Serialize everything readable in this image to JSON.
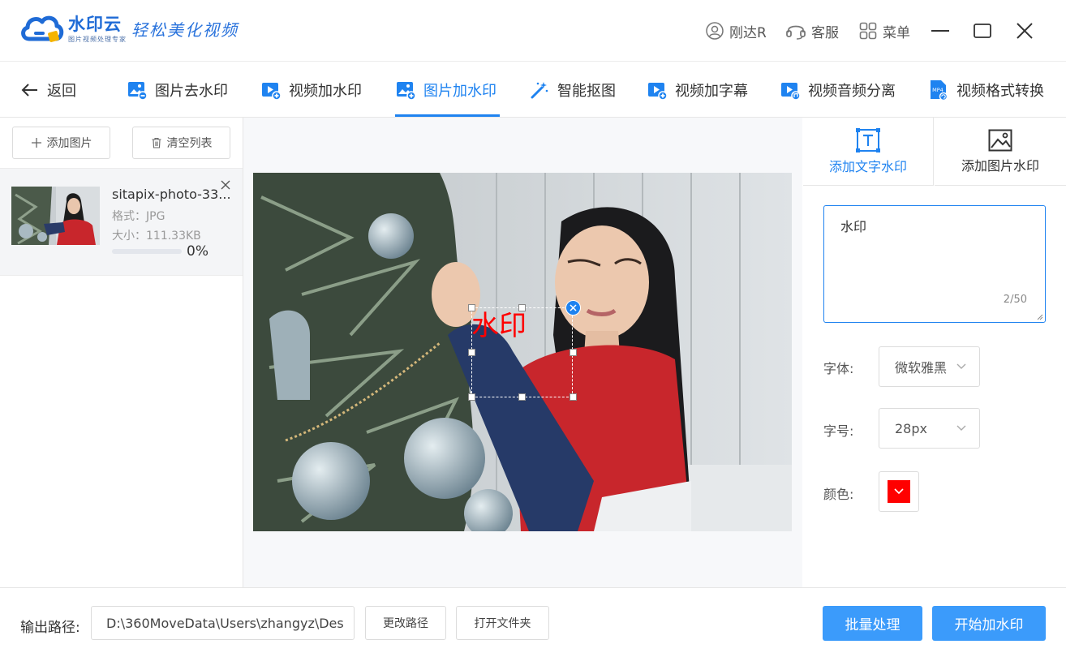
{
  "app": {
    "name": "水印云",
    "subtitle": "图片视频处理专家",
    "slogan": "轻松美化视频"
  },
  "titlebar": {
    "user": "刚达R",
    "service": "客服",
    "menu": "菜单"
  },
  "nav": {
    "back": "返回",
    "tabs": [
      {
        "label": "图片去水印"
      },
      {
        "label": "视频加水印"
      },
      {
        "label": "图片加水印",
        "active": true
      },
      {
        "label": "智能抠图"
      },
      {
        "label": "视频加字幕"
      },
      {
        "label": "视频音频分离"
      },
      {
        "label": "视频格式转换"
      }
    ]
  },
  "left": {
    "add_button": "添加图片",
    "clear_button": "清空列表",
    "file": {
      "name": "sitapix-photo-33...",
      "format": "格式：JPG",
      "size": "大小：111.33KB",
      "progress_text": "0%",
      "progress": 0
    }
  },
  "canvas": {
    "watermark_text": "水印"
  },
  "right": {
    "tab_text": "添加文字水印",
    "tab_image": "添加图片水印",
    "input_value": "水印",
    "counter": "2/50",
    "font_label": "字体:",
    "font_value": "微软雅黑",
    "size_label": "字号:",
    "size_value": "28px",
    "color_label": "颜色:",
    "color_value": "#ff0000"
  },
  "footer": {
    "output_label": "输出路径:",
    "output_path": "D:\\360MoveData\\Users\\zhangyz\\Des",
    "change_path": "更改路径",
    "open_folder": "打开文件夹",
    "batch": "批量处理",
    "start": "开始加水印"
  },
  "colors": {
    "accent": "#1f83f0",
    "primary_button": "#3b9bfb",
    "watermark": "#ff0000"
  }
}
